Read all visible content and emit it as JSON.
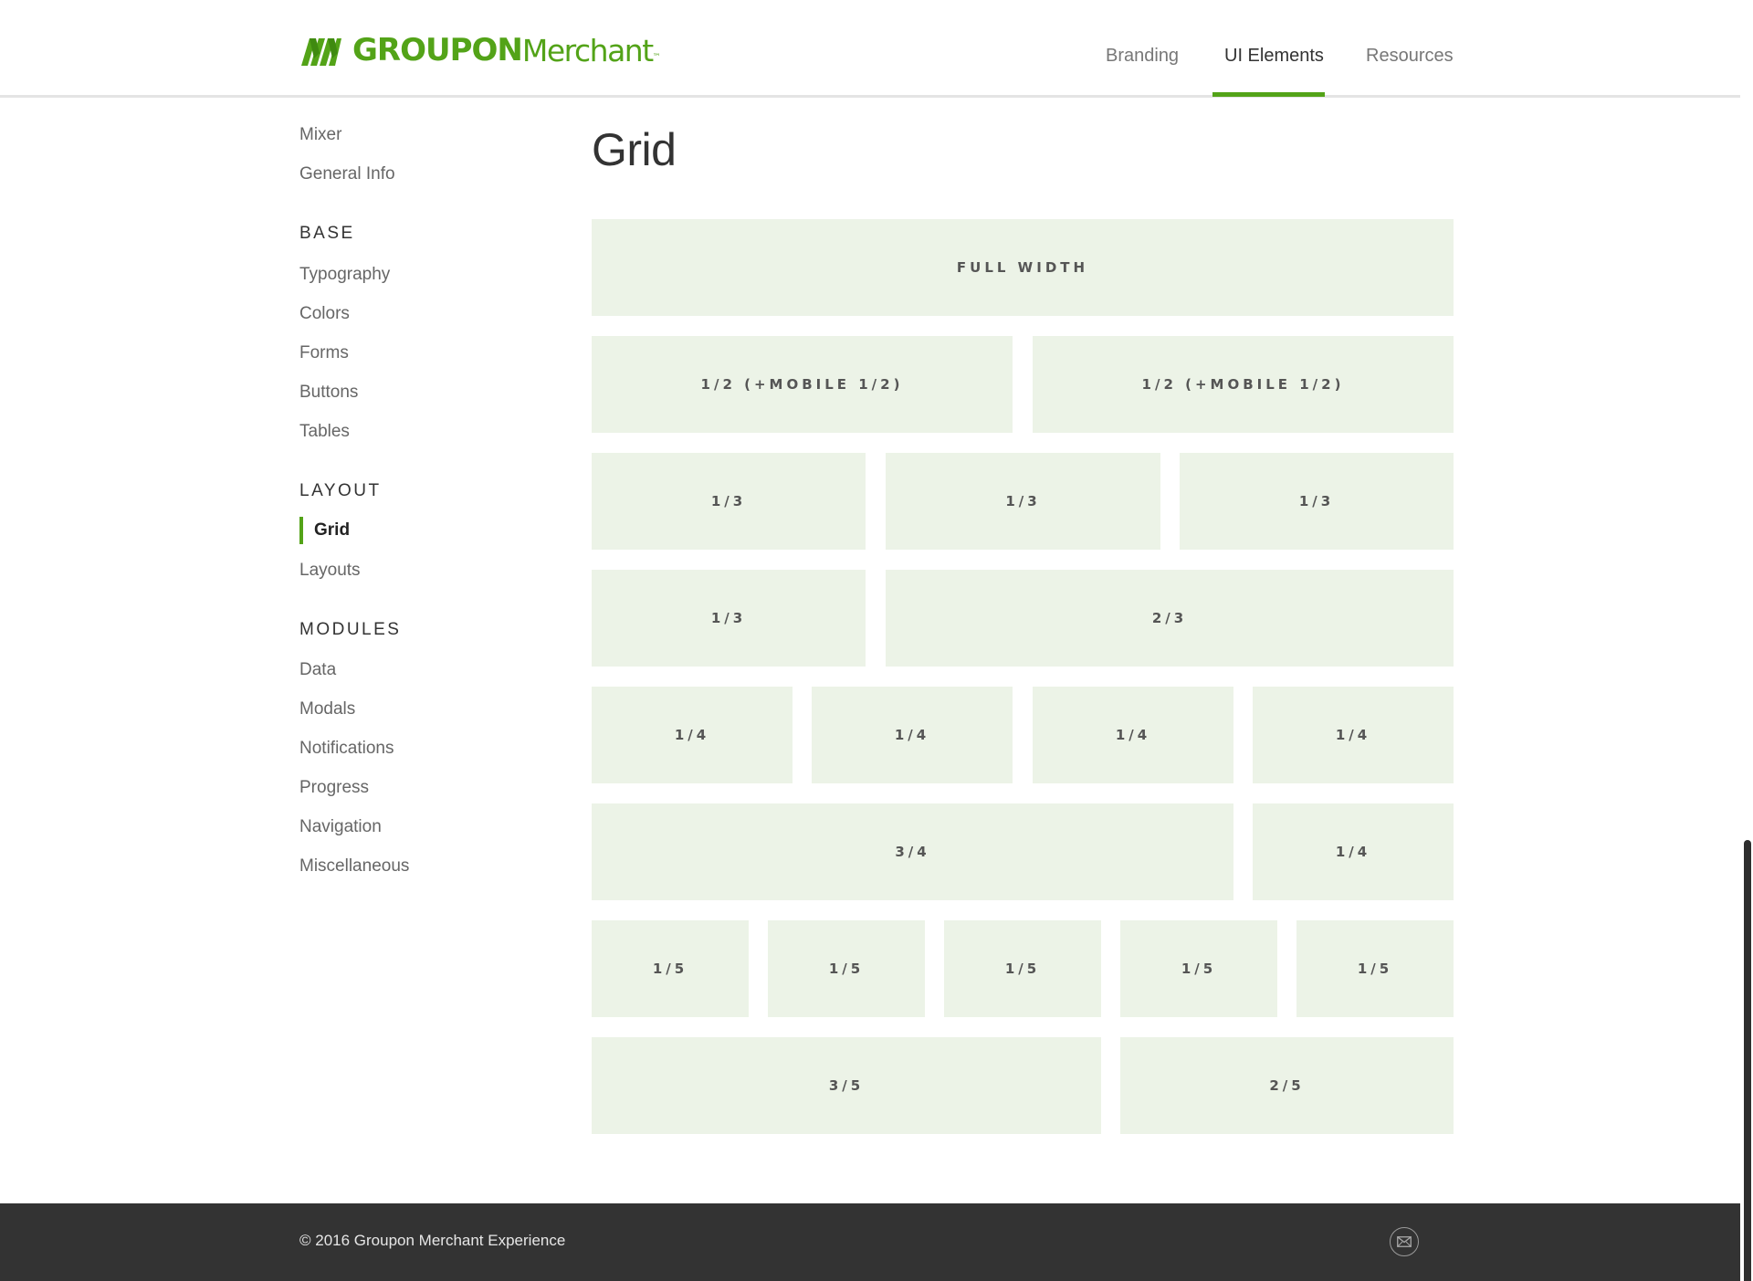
{
  "header": {
    "logo": {
      "brand": "GROUPON",
      "product": "Merchant",
      "tm": "™",
      "color": "#53a318"
    },
    "nav": [
      {
        "label": "Branding",
        "active": false
      },
      {
        "label": "UI Elements",
        "active": true
      },
      {
        "label": "Resources",
        "active": false
      }
    ]
  },
  "sidebar": {
    "top_links": [
      "Mixer",
      "General Info"
    ],
    "sections": [
      {
        "heading": "BASE",
        "items": [
          "Typography",
          "Colors",
          "Forms",
          "Buttons",
          "Tables"
        ]
      },
      {
        "heading": "LAYOUT",
        "items": [
          "Grid",
          "Layouts"
        ],
        "active_item": "Grid"
      },
      {
        "heading": "MODULES",
        "items": [
          "Data",
          "Modals",
          "Notifications",
          "Progress",
          "Navigation",
          "Miscellaneous"
        ]
      }
    ]
  },
  "main": {
    "title": "Grid",
    "rows": [
      [
        "FULL WIDTH"
      ],
      [
        "1/2 (+MOBILE 1/2)",
        "1/2 (+MOBILE 1/2)"
      ],
      [
        "1/3",
        "1/3",
        "1/3"
      ],
      [
        "1/3",
        "2/3"
      ],
      [
        "1/4",
        "1/4",
        "1/4",
        "1/4"
      ],
      [
        "3/4",
        "1/4"
      ],
      [
        "1/5",
        "1/5",
        "1/5",
        "1/5",
        "1/5"
      ],
      [
        "3/5",
        "2/5"
      ]
    ]
  },
  "footer": {
    "copyright": "© 2016 Groupon Merchant Experience",
    "icon": "mail-icon"
  },
  "colors": {
    "accent": "#53a318",
    "cell_bg": "#ecf3e7",
    "footer_bg": "#333333"
  }
}
